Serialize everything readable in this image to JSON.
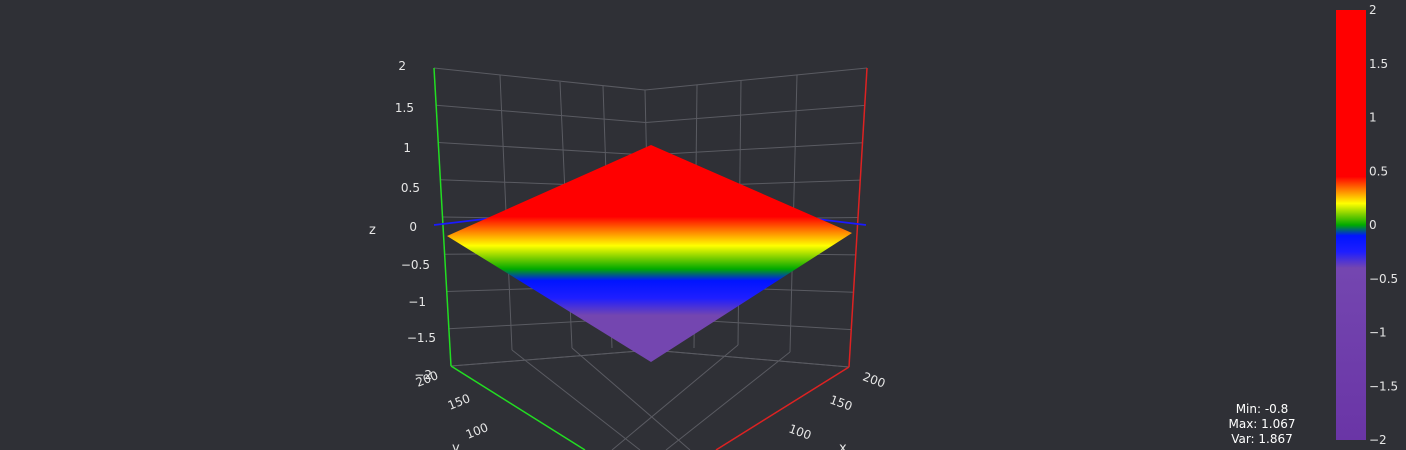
{
  "chart_data": {
    "type": "surface",
    "title": "",
    "x_axis": {
      "label": "x",
      "ticks": [
        "100",
        "150",
        "200"
      ],
      "color": "#e31a1a"
    },
    "y_axis": {
      "label": "y",
      "ticks": [
        "100",
        "150",
        "200"
      ],
      "color": "#22dd22"
    },
    "z_axis": {
      "label": "z",
      "range": [
        -2,
        2
      ],
      "ticks": [
        "2",
        "1.5",
        "1",
        "0.5",
        "0",
        "−0.5",
        "−1",
        "−1.5",
        "−2"
      ]
    },
    "surface": {
      "shape": "tilted plane (diamond-shaped patch)",
      "z_min": -0.8,
      "z_max": 1.067
    },
    "zero_contour_color": "#1a1aff",
    "colorbar": {
      "range": [
        -2,
        2
      ],
      "ticks": [
        "2",
        "1.5",
        "1",
        "0.5",
        "0",
        "−0.5",
        "−1",
        "−1.5",
        "−2"
      ],
      "stops": [
        {
          "value": -2.0,
          "color": "#6a35a6"
        },
        {
          "value": -0.4,
          "color": "#7446b0"
        },
        {
          "value": -0.25,
          "color": "#1e1eff"
        },
        {
          "value": -0.1,
          "color": "#0014ff"
        },
        {
          "value": 0.0,
          "color": "#00aa00"
        },
        {
          "value": 0.1,
          "color": "#80d000"
        },
        {
          "value": 0.2,
          "color": "#ffff00"
        },
        {
          "value": 0.3,
          "color": "#ff9900"
        },
        {
          "value": 0.45,
          "color": "#ff0000"
        },
        {
          "value": 2.0,
          "color": "#ff0000"
        }
      ]
    }
  },
  "stats": {
    "min": "Min: -0.8",
    "max": "Max: 1.067",
    "var": "Var: 1.867"
  }
}
